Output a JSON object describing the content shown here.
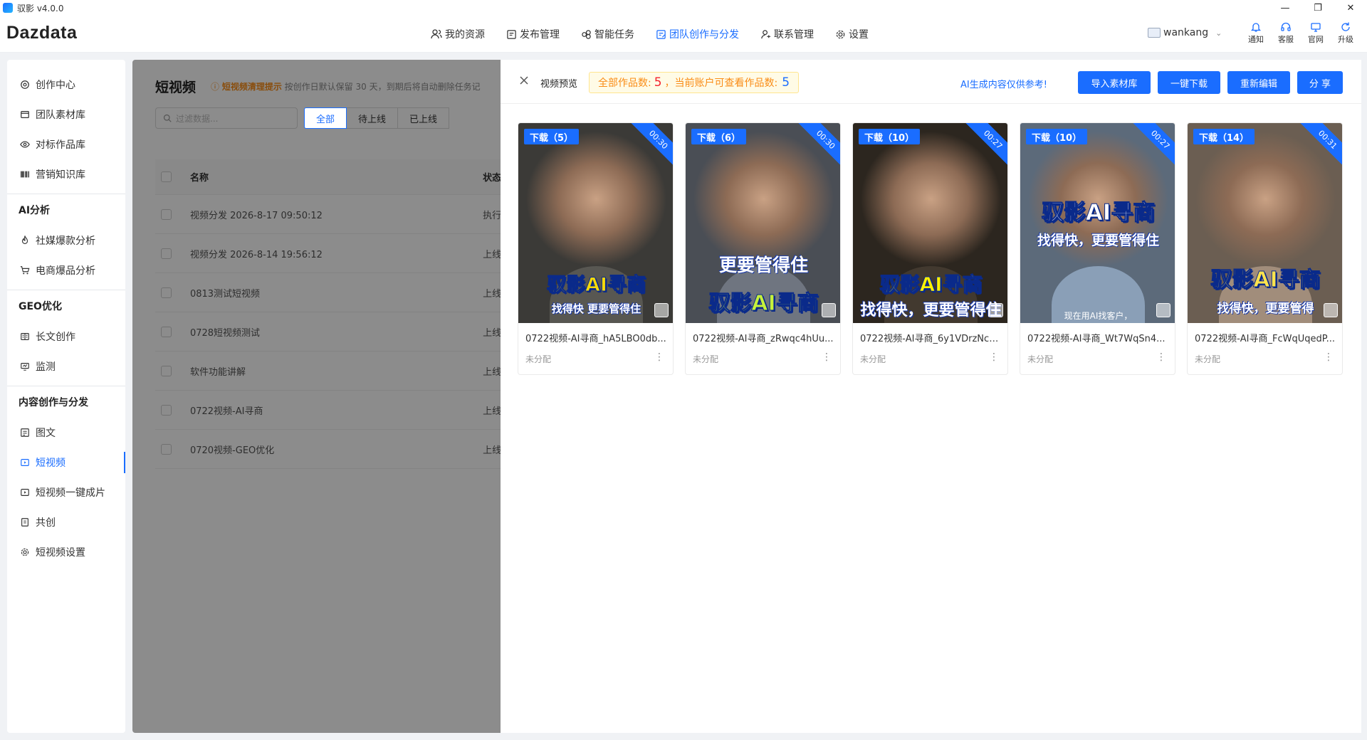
{
  "window": {
    "app_title": "驭影 v4.0.0"
  },
  "header": {
    "logo": "Dazdata",
    "nav": [
      {
        "label": "我的资源",
        "icon": "users-icon"
      },
      {
        "label": "发布管理",
        "icon": "publish-icon"
      },
      {
        "label": "智能任务",
        "icon": "task-icon"
      },
      {
        "label": "团队创作与分发",
        "icon": "team-create-icon",
        "active": true
      },
      {
        "label": "联系管理",
        "icon": "contact-icon"
      },
      {
        "label": "设置",
        "icon": "gear-icon"
      }
    ],
    "user": "wankang",
    "icons": [
      {
        "label": "通知",
        "icon": "bell-icon"
      },
      {
        "label": "客服",
        "icon": "headset-icon"
      },
      {
        "label": "官网",
        "icon": "website-icon"
      },
      {
        "label": "升级",
        "icon": "refresh-icon"
      }
    ]
  },
  "sidebar": {
    "top_items": [
      {
        "label": "创作中心",
        "icon": "at-icon"
      },
      {
        "label": "团队素材库",
        "icon": "folder-icon"
      },
      {
        "label": "对标作品库",
        "icon": "eye-icon"
      },
      {
        "label": "营销知识库",
        "icon": "barcode-icon"
      }
    ],
    "groups": [
      {
        "title": "AI分析",
        "items": [
          {
            "label": "社媒爆款分析",
            "icon": "flame-icon"
          },
          {
            "label": "电商爆品分析",
            "icon": "cart-icon"
          }
        ]
      },
      {
        "title": "GEO优化",
        "items": [
          {
            "label": "长文创作",
            "icon": "book-icon"
          },
          {
            "label": "监测",
            "icon": "monitor-icon"
          }
        ]
      },
      {
        "title": "内容创作与分发",
        "items": [
          {
            "label": "图文",
            "icon": "image-text-icon"
          },
          {
            "label": "短视频",
            "icon": "video-icon",
            "active": true
          },
          {
            "label": "短视频一键成片",
            "icon": "video-play-icon"
          },
          {
            "label": "共创",
            "icon": "co-create-icon"
          },
          {
            "label": "短视频设置",
            "icon": "gear-icon"
          }
        ]
      }
    ]
  },
  "main": {
    "title": "短视频",
    "notice_bold": "短视频清理提示",
    "notice_rest": "按创作日默认保留 30 天，到期后将自动删除任务记",
    "search_placeholder": "过滤数据...",
    "tabs": [
      "全部",
      "待上线",
      "已上线"
    ],
    "table": {
      "headers": [
        "名称",
        "状态"
      ],
      "rows": [
        {
          "name": "视频分发 2026-8-17 09:50:12",
          "state": "执行"
        },
        {
          "name": "视频分发 2026-8-14 19:56:12",
          "state": "上线"
        },
        {
          "name": "0813测试短视频",
          "state": "上线"
        },
        {
          "name": "0728短视频测试",
          "state": "上线"
        },
        {
          "name": "软件功能讲解",
          "state": "上线"
        },
        {
          "name": "0722视频-AI寻商",
          "state": "上线"
        },
        {
          "name": "0720视频-GEO优化",
          "state": "上线"
        }
      ]
    }
  },
  "drawer": {
    "title": "视频预览",
    "count_label_1": "全部作品数:",
    "count_total": "5",
    "count_label_2": "，当前账户可查看作品数:",
    "count_visible": "5",
    "ai_note": "AI生成内容仅供参考!",
    "buttons": [
      "导入素材库",
      "一键下载",
      "重新编辑",
      "分 享"
    ],
    "cards": [
      {
        "download": "下载（5）",
        "duration": "00:30",
        "name": "0722视频-AI寻商_hA5LBO0db...",
        "status": "未分配",
        "caption_main": "驭影AI寻商",
        "caption_sub": "找得快 更要管得住",
        "bg": "#3b3a37",
        "accent": "#f5d90a"
      },
      {
        "download": "下载（6）",
        "duration": "00:30",
        "name": "0722视频-AI寻商_zRwqc4hUu...",
        "status": "未分配",
        "caption_main": "驭影AI寻商",
        "caption_sub": "更要管得住",
        "bg": "#4a4e55",
        "accent": "#c6f13b"
      },
      {
        "download": "下载（10）",
        "duration": "00:27",
        "name": "0722视频-AI寻商_6y1VDrzNcz...",
        "status": "未分配",
        "caption_main": "驭影AI寻商",
        "caption_sub": "找得快，更要管得住",
        "bg": "#2c261f",
        "accent": "#fff200"
      },
      {
        "download": "下载（10）",
        "duration": "00:27",
        "name": "0722视频-AI寻商_Wt7WqSn4...",
        "status": "未分配",
        "caption_main": "驭影AI寻商",
        "caption_sub": "找得快，更要管得住",
        "bg": "#5c6a7a",
        "accent": "#ffffff",
        "caption_bottom": "现在用AI找客户，"
      },
      {
        "download": "下载（14）",
        "duration": "00:31",
        "name": "0722视频-AI寻商_FcWqUqedP...",
        "status": "未分配",
        "caption_main": "驭影AI寻商",
        "caption_sub": "找得快，更要管得",
        "bg": "#6b5e52",
        "accent": "#ffe34d"
      }
    ]
  },
  "colors": {
    "primary": "#1a6dff",
    "warning": "#fa8c16",
    "danger": "#f5222d"
  }
}
